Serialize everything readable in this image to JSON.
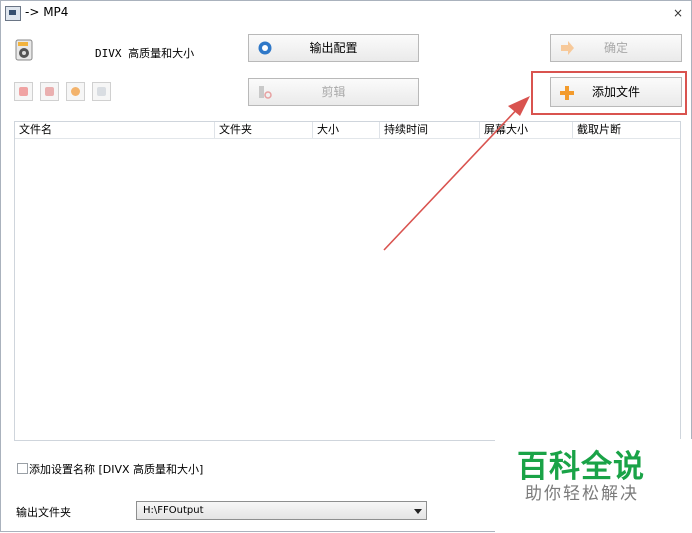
{
  "window": {
    "title": "-> MP4",
    "close_glyph": "×"
  },
  "preset": {
    "label": "DIVX 高质量和大小",
    "icon": "divx-preset-icon"
  },
  "buttons": {
    "output_config": "输出配置",
    "confirm": "确定",
    "edit": "剪辑",
    "add_file": "添加文件"
  },
  "toolbar_icons": [
    "file-remove-icon",
    "file-clear-icon",
    "play-icon",
    "media-info-icon"
  ],
  "table": {
    "headers": [
      "文件名",
      "文件夹",
      "大小",
      "持续时间",
      "屏幕大小",
      "截取片断"
    ],
    "rows": []
  },
  "options": {
    "add_preset_name_label": "添加设置名称 [DIVX 高质量和大小]",
    "add_preset_name_checked": false
  },
  "output": {
    "label": "输出文件夹",
    "folder": "H:\\FFOutput"
  },
  "watermark": {
    "main": "百科全说",
    "sub": "助你轻松解决"
  },
  "colors": {
    "highlight": "#d9534f",
    "watermark_green": "#1aa347",
    "accent_orange": "#f39b2c"
  }
}
